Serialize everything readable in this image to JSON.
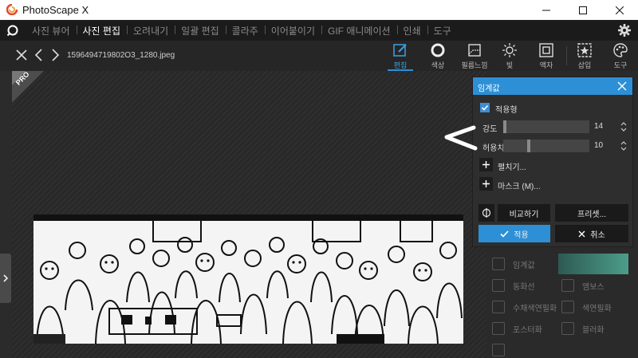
{
  "window": {
    "title": "PhotoScape X"
  },
  "menu": {
    "items": [
      {
        "label": "사진 뷰어",
        "active": false
      },
      {
        "label": "사진 편집",
        "active": true
      },
      {
        "label": "오려내기",
        "active": false
      },
      {
        "label": "일괄 편집",
        "active": false
      },
      {
        "label": "콜라주",
        "active": false
      },
      {
        "label": "이어붙이기",
        "active": false
      },
      {
        "label": "GIF 애니메이션",
        "active": false
      },
      {
        "label": "인쇄",
        "active": false
      },
      {
        "label": "도구",
        "active": false
      }
    ]
  },
  "toolbar": {
    "filename": "1596494719802O3_1280.jpeg",
    "tools": [
      {
        "label": "편집",
        "icon": "edit-icon"
      },
      {
        "label": "색상",
        "icon": "color-circle-icon"
      },
      {
        "label": "필름느낌",
        "icon": "film-icon"
      },
      {
        "label": "빛",
        "icon": "light-icon"
      },
      {
        "label": "액자",
        "icon": "frame-icon"
      },
      {
        "label": "삽입",
        "icon": "insert-icon"
      },
      {
        "label": "도구",
        "icon": "palette-icon"
      }
    ]
  },
  "badge": {
    "text": "PRO"
  },
  "dialog": {
    "title": "임계값",
    "apply_checkbox": {
      "label": "적용형",
      "checked": true
    },
    "sliders": [
      {
        "label": "강도",
        "value": "14",
        "fraction": 0.0
      },
      {
        "label": "허용치",
        "value": "10",
        "fraction": 0.28
      }
    ],
    "expand": "펼치기...",
    "mask": "마스크 (M)...",
    "compare": "비교하기",
    "preset": "프리셋...",
    "apply": "적용",
    "cancel": "취소"
  },
  "side_panel": {
    "items": [
      "임계값",
      "동화선",
      "수채색연필화",
      "포스터화",
      "엠보스",
      "색연필화",
      "블러화"
    ]
  },
  "colors": {
    "accent": "#2d8fd5",
    "menu_bg": "#1b1b1b",
    "canvas_bg": "#2d2d2d"
  }
}
